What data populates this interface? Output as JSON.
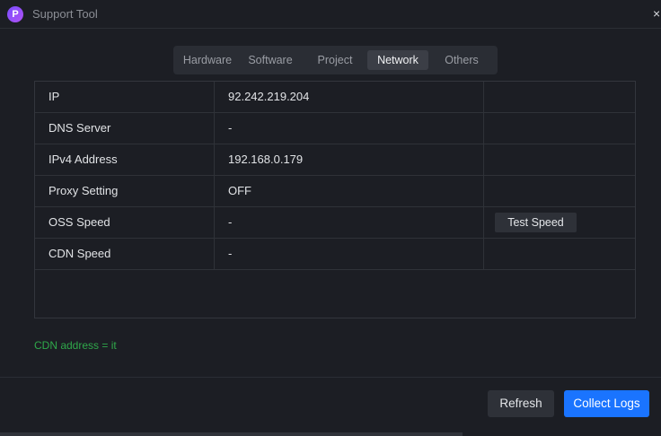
{
  "window": {
    "title": "Support Tool",
    "logo_letter": "P",
    "close_glyph": "×"
  },
  "tabs": [
    {
      "label": "Hardware",
      "active": false
    },
    {
      "label": "Software",
      "active": false
    },
    {
      "label": "Project",
      "active": false
    },
    {
      "label": "Network",
      "active": true
    },
    {
      "label": "Others",
      "active": false
    }
  ],
  "network_table": {
    "rows": [
      {
        "name": "IP",
        "value": "92.242.219.204"
      },
      {
        "name": "DNS Server",
        "value": "-"
      },
      {
        "name": "IPv4 Address",
        "value": "192.168.0.179"
      },
      {
        "name": "Proxy Setting",
        "value": "OFF"
      },
      {
        "name": "OSS Speed",
        "value": "-",
        "action": "Test Speed"
      },
      {
        "name": "CDN Speed",
        "value": "-"
      }
    ]
  },
  "cdn_note": "CDN address = it",
  "footer": {
    "refresh_label": "Refresh",
    "collect_label": "Collect Logs"
  },
  "colors": {
    "background": "#1c1e24",
    "accent": "#1a74ff",
    "note_green": "#2fa84a",
    "logo": "#8a4cf7"
  }
}
